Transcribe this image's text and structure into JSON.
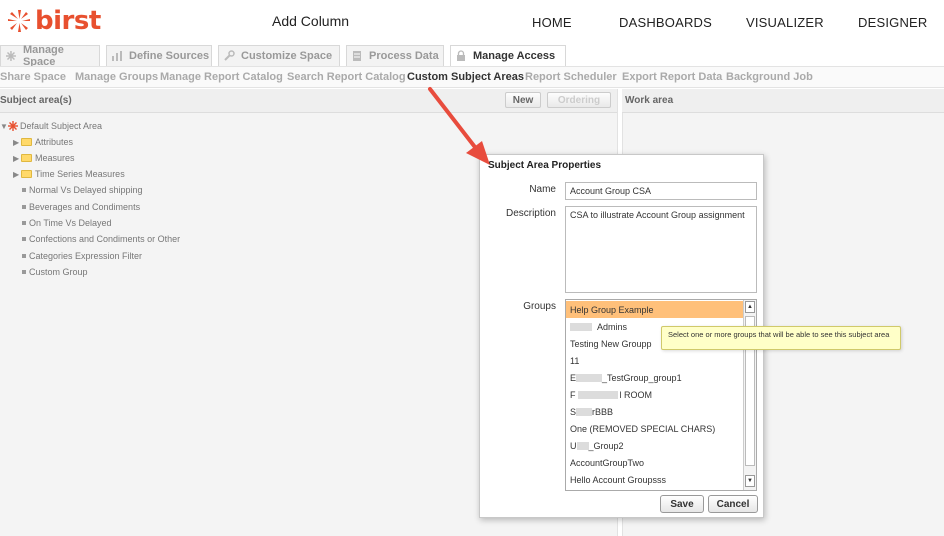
{
  "brand": {
    "logo_text": "birst",
    "accent": "#e8502f"
  },
  "header": {
    "page_title": "Add Column"
  },
  "topnav": [
    "HOME",
    "DASHBOARDS",
    "VISUALIZER",
    "DESIGNER"
  ],
  "tabs": [
    {
      "label": "Manage Space",
      "icon": "manage-space-icon"
    },
    {
      "label": "Define Sources",
      "icon": "define-sources-icon"
    },
    {
      "label": "Customize Space",
      "icon": "wrench-icon"
    },
    {
      "label": "Process Data",
      "icon": "process-data-icon"
    },
    {
      "label": "Manage Access",
      "icon": "lock-icon"
    }
  ],
  "subnav": [
    "Share Space",
    "Manage Groups",
    "Manage Report Catalog",
    "Search Report Catalog",
    "Custom Subject Areas",
    "Report Scheduler",
    "Export Report Data",
    "Background Job"
  ],
  "left_panel": {
    "title": "Subject area(s)",
    "new_label": "New",
    "ordering_label": "Ordering"
  },
  "right_panel": {
    "title": "Work area"
  },
  "tree": {
    "root": "Default Subject Area",
    "folders": [
      "Attributes",
      "Measures",
      "Time Series Measures"
    ],
    "items": [
      "Normal Vs Delayed shipping",
      "Beverages and Condiments",
      "On Time Vs Delayed",
      "Confections and Condiments or Other",
      "Categories Expression Filter",
      "Custom Group"
    ]
  },
  "dialog": {
    "title": "Subject Area Properties",
    "name_label": "Name",
    "name_value": "Account Group CSA",
    "description_label": "Description",
    "description_value": "CSA to illustrate Account Group assignment",
    "groups_label": "Groups",
    "groups": [
      {
        "prefix": "",
        "text": "Help Group Example",
        "selected": true
      },
      {
        "prefix": "",
        "text": "Admins",
        "selected": false
      },
      {
        "prefix": "",
        "text": "Testing New Groupp",
        "selected": false
      },
      {
        "prefix": "",
        "text": "11",
        "selected": false
      },
      {
        "prefix": "E",
        "text": "_TestGroup_group1",
        "selected": false
      },
      {
        "prefix": "F",
        "text": "l ROOM",
        "selected": false
      },
      {
        "prefix": "S",
        "text": "rBBB",
        "selected": false
      },
      {
        "prefix": "",
        "text": "One (REMOVED SPECIAL CHARS)",
        "selected": false
      },
      {
        "prefix": "U",
        "text": "_Group2",
        "selected": false
      },
      {
        "prefix": "",
        "text": "AccountGroupTwo",
        "selected": false
      },
      {
        "prefix": "",
        "text": "Hello Account Groupsss",
        "selected": false
      }
    ],
    "save_label": "Save",
    "cancel_label": "Cancel"
  },
  "tooltip": {
    "text": "Select one or more groups that will be able to see this subject area"
  },
  "colors": {
    "selected_row": "#ffc07a",
    "tooltip_bg": "#ffffc8",
    "annotation_arrow": "#e84c3d"
  }
}
